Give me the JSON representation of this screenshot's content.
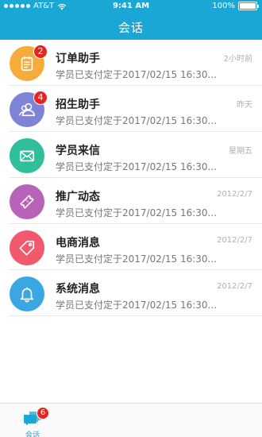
{
  "status_bar": {
    "carrier": "AT&T",
    "time": "9:41 AM",
    "battery": "100%",
    "battery_level": 1.0
  },
  "nav": {
    "title": "会话"
  },
  "conversations": [
    {
      "title": "订单助手",
      "preview": "学员已支付定于2017/02/15 16:30...",
      "time": "2小时前",
      "badge": "2",
      "color": "#f5ac3a",
      "icon": "notepad-icon"
    },
    {
      "title": "招生助手",
      "preview": "学员已支付定于2017/02/15 16:30...",
      "time": "昨天",
      "badge": "4",
      "color": "#7f83d6",
      "icon": "user-group-icon"
    },
    {
      "title": "学员来信",
      "preview": "学员已支付定于2017/02/15 16:30...",
      "time": "星期五",
      "badge": "",
      "color": "#2fbf9a",
      "icon": "envelope-icon"
    },
    {
      "title": "推广动态",
      "preview": "学员已支付定于2017/02/15 16:30...",
      "time": "2012/2/7",
      "badge": "",
      "color": "#b763b8",
      "icon": "ticket-icon"
    },
    {
      "title": "电商消息",
      "preview": "学员已支付定于2017/02/15 16:30...",
      "time": "2012/2/7",
      "badge": "",
      "color": "#f2596c",
      "icon": "tag-icon"
    },
    {
      "title": "系统消息",
      "preview": "学员已支付定于2017/02/15 16:30...",
      "time": "2012/2/7",
      "badge": "",
      "color": "#3aa7e3",
      "icon": "bell-icon"
    }
  ],
  "tabbar": {
    "tabs": [
      {
        "label": "会话",
        "badge": "6",
        "icon": "chat-bubbles-icon",
        "active": true
      }
    ]
  },
  "colors": {
    "header": "#1aa7d6",
    "badge": "#e8241f",
    "accent": "#1aa7d6"
  }
}
